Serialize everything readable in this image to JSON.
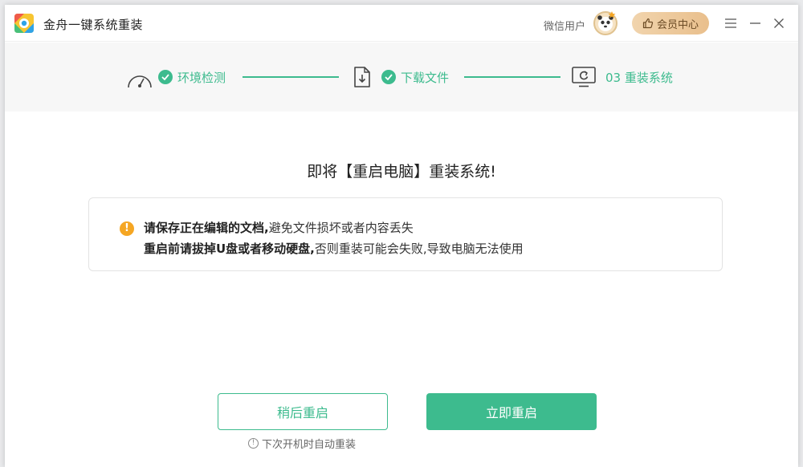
{
  "app": {
    "title": "金舟一键系统重装",
    "user_name": "微信用户",
    "vip_label": "会员中心"
  },
  "steps": [
    {
      "label": "环境检测",
      "status": "done",
      "icon": "gauge-icon"
    },
    {
      "label": "下载文件",
      "status": "done",
      "icon": "download-file-icon"
    },
    {
      "label": "03 重装系统",
      "status": "current",
      "icon": "monitor-refresh-icon"
    }
  ],
  "main": {
    "headline": "即将【重启电脑】重装系统!",
    "notice": {
      "line1_bold": "请保存正在编辑的文档,",
      "line1_rest": "避免文件损坏或者内容丢失",
      "line2_bold": "重启前请拔掉U盘或者移动硬盘,",
      "line2_rest": "否则重装可能会失败,导致电脑无法使用"
    },
    "later_button": "稍后重启",
    "now_button": "立即重启",
    "hint": "下次开机时自动重装"
  },
  "colors": {
    "accent": "#3dbb8e",
    "warning": "#f5a623",
    "vip": "#e9bf8c"
  }
}
